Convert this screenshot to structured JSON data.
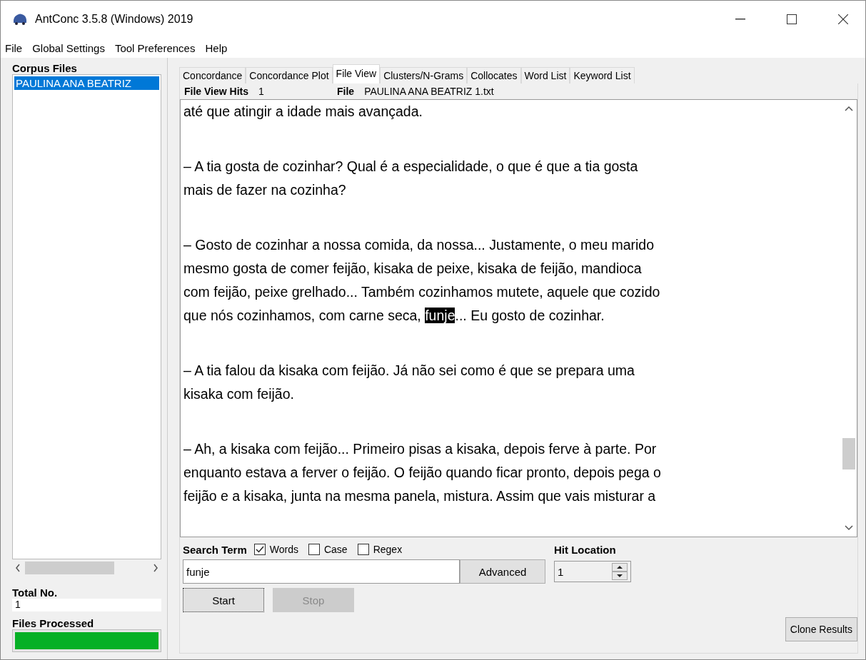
{
  "window": {
    "title": "AntConc 3.5.8 (Windows) 2019"
  },
  "menu": [
    "File",
    "Global Settings",
    "Tool Preferences",
    "Help"
  ],
  "sidebar": {
    "heading": "Corpus Files",
    "files": [
      {
        "name": "PAULINA ANA BEATRIZ",
        "selected": true
      }
    ],
    "total_label": "Total No.",
    "total_value": "1",
    "processed_label": "Files Processed",
    "processed": {
      "level": 1
    }
  },
  "tabs": [
    {
      "label": "Concordance",
      "selected": false
    },
    {
      "label": "Concordance Plot",
      "selected": false
    },
    {
      "label": "File View",
      "selected": true
    },
    {
      "label": "Clusters/N-Grams",
      "selected": false
    },
    {
      "label": "Collocates",
      "selected": false
    },
    {
      "label": "Word List",
      "selected": false
    },
    {
      "label": "Keyword List",
      "selected": false
    }
  ],
  "file_view": {
    "hits_label": "File View Hits",
    "hits_value": "1",
    "file_label": "File",
    "file_value": "PAULINA ANA BEATRIZ 1.txt",
    "paragraphs": [
      {
        "lines": [
          [
            {
              "text": "até que atingir a idade mais avançada.",
              "highlighted": false
            }
          ]
        ]
      },
      {
        "lines": [
          [
            {
              "text": "– A tia gosta de cozinhar? Qual é a especialidade, o que é que a tia gosta",
              "highlighted": false
            }
          ],
          [
            {
              "text": "mais de fazer na cozinha?",
              "highlighted": false
            }
          ]
        ]
      },
      {
        "lines": [
          [
            {
              "text": "– Gosto de cozinhar a nossa comida, da nossa... Justamente, o meu marido",
              "highlighted": false
            }
          ],
          [
            {
              "text": "mesmo gosta de comer feijão, kisaka de peixe, kisaka de feijão, mandioca",
              "highlighted": false
            }
          ],
          [
            {
              "text": "com feijão, peixe grelhado... Também cozinhamos mutete, aquele que cozido",
              "highlighted": false
            }
          ],
          [
            {
              "text": "que nós cozinhamos, com carne seca, ",
              "highlighted": false
            },
            {
              "text": "funje",
              "highlighted": true
            },
            {
              "text": "... Eu gosto de cozinhar.",
              "highlighted": false
            }
          ]
        ]
      },
      {
        "lines": [
          [
            {
              "text": "– A tia falou da kisaka com feijão. Já não sei como é que se prepara uma",
              "highlighted": false
            }
          ],
          [
            {
              "text": "kisaka com feijão.",
              "highlighted": false
            }
          ]
        ]
      },
      {
        "lines": [
          [
            {
              "text": "– Ah, a kisaka com feijão... Primeiro pisas a kisaka, depois ferve à parte. Por",
              "highlighted": false
            }
          ],
          [
            {
              "text": "enquanto estava a ferver o feijão. O feijão quando ficar pronto, depois pega o",
              "highlighted": false
            }
          ],
          [
            {
              "text": "feijão e a kisaka, junta na mesma panela, mistura. Assim que vais misturar a",
              "highlighted": false
            }
          ]
        ]
      }
    ]
  },
  "search": {
    "label": "Search Term",
    "options": [
      {
        "label": "Words",
        "checked": true
      },
      {
        "label": "Case",
        "checked": false
      },
      {
        "label": "Regex",
        "checked": false
      }
    ],
    "value": "funje",
    "advanced": "Advanced",
    "hit_location_label": "Hit Location",
    "hit_location_value": "1",
    "start": {
      "label": "Start",
      "disabled": false
    },
    "stop": {
      "label": "Stop",
      "disabled": true
    }
  },
  "clone_button": "Clone Results"
}
